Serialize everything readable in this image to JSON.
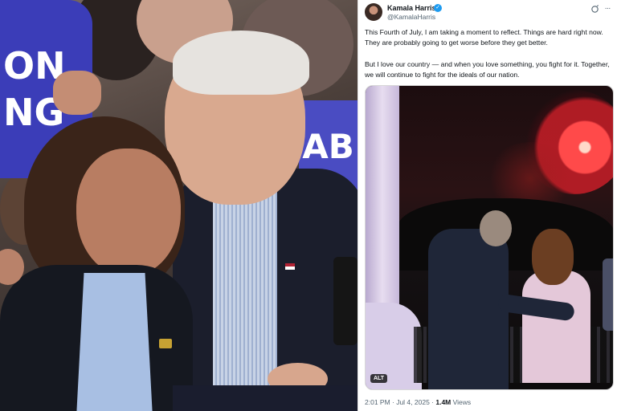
{
  "left_photo": {
    "sign_left_lines": [
      "ON",
      "NG"
    ],
    "sign_right_text": "AB"
  },
  "tweet": {
    "author": {
      "name": "Kamala Harris",
      "handle": "@KamalaHarris",
      "verified": true
    },
    "icons": {
      "verified": "verified-badge-icon",
      "grok": "grok-icon",
      "more": "more-icon"
    },
    "text": {
      "p1": "This Fourth of July, I am taking a moment to reflect. Things are hard right now. They are probably going to get worse before they get better.",
      "p2": "But I love our country — and when you love something, you fight for it. Together, we will continue to fight for the ideals of our nation."
    },
    "media": {
      "alt_badge": "ALT"
    },
    "meta": {
      "time": "2:01 PM · Jul 4, 2025 · ",
      "views_count": "1.4M",
      "views_label": " Views"
    }
  },
  "colors": {
    "sign_blue": "#3b3db8",
    "verified_blue": "#1d9bf0",
    "text_primary": "#0f1419",
    "text_secondary": "#536471"
  }
}
